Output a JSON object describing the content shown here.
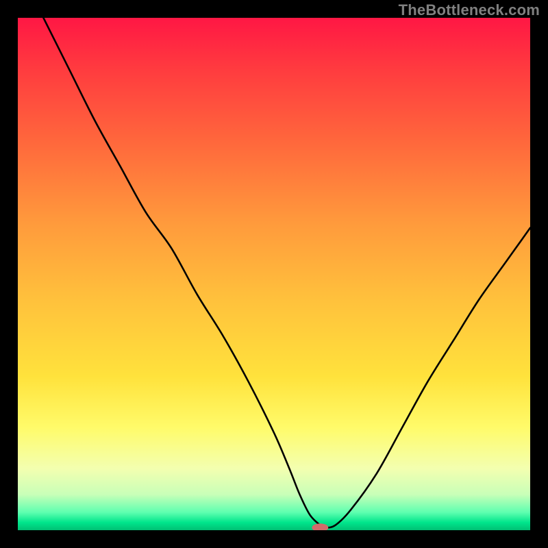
{
  "watermark": "TheBottleneck.com",
  "chart_data": {
    "type": "line",
    "title": "",
    "xlabel": "",
    "ylabel": "",
    "xlim": [
      0,
      100
    ],
    "ylim": [
      0,
      100
    ],
    "grid": false,
    "legend": false,
    "gradient_stops": [
      {
        "offset": 0.0,
        "color": "#ff1744"
      },
      {
        "offset": 0.1,
        "color": "#ff3b3f"
      },
      {
        "offset": 0.25,
        "color": "#ff6a3c"
      },
      {
        "offset": 0.4,
        "color": "#ff9a3c"
      },
      {
        "offset": 0.55,
        "color": "#ffc13c"
      },
      {
        "offset": 0.7,
        "color": "#ffe23c"
      },
      {
        "offset": 0.8,
        "color": "#fffb6a"
      },
      {
        "offset": 0.88,
        "color": "#f3ffb0"
      },
      {
        "offset": 0.93,
        "color": "#c9ffb8"
      },
      {
        "offset": 0.965,
        "color": "#5fffb0"
      },
      {
        "offset": 0.985,
        "color": "#00e58b"
      },
      {
        "offset": 1.0,
        "color": "#00c074"
      }
    ],
    "series": [
      {
        "name": "bottleneck-curve",
        "color": "#000000",
        "x": [
          5,
          10,
          15,
          20,
          25,
          30,
          35,
          40,
          45,
          50,
          53,
          55,
          57,
          59,
          60,
          62,
          65,
          70,
          75,
          80,
          85,
          90,
          95,
          100
        ],
        "values": [
          100,
          90,
          80,
          71,
          62,
          55,
          46,
          38,
          29,
          19,
          12,
          7,
          3,
          1,
          0.5,
          1,
          4,
          11,
          20,
          29,
          37,
          45,
          52,
          59
        ]
      }
    ],
    "marker": {
      "name": "optimum-marker",
      "x": 59,
      "y": 0.5,
      "color": "#d26a6a",
      "rx": 12,
      "ry": 6
    }
  }
}
